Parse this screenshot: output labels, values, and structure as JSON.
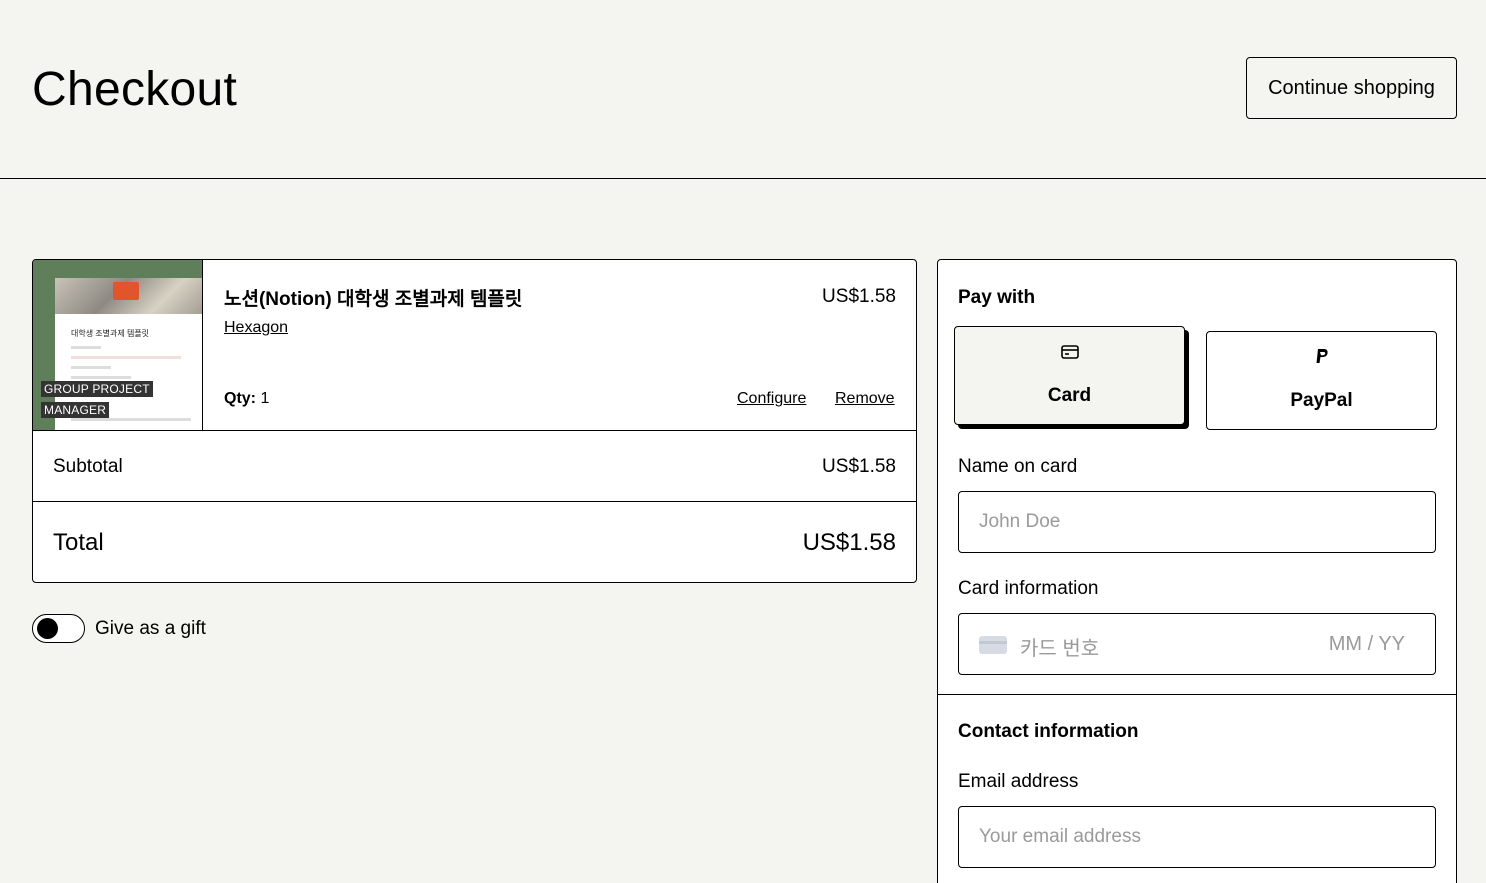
{
  "header": {
    "title": "Checkout",
    "continue_label": "Continue shopping"
  },
  "cart": {
    "item": {
      "name": "노션(Notion) 대학생 조별과제 템플릿",
      "seller": "Hexagon",
      "price": "US$1.58",
      "qty_label": "Qty:",
      "qty_value": "1",
      "configure_label": "Configure",
      "remove_label": "Remove",
      "thumbnail": {
        "doc_title": "대학생 조별과제 템플릿",
        "label_line1": "GROUP PROJECT",
        "label_line2": "MANAGER"
      }
    },
    "subtotal_label": "Subtotal",
    "subtotal_value": "US$1.58",
    "total_label": "Total",
    "total_value": "US$1.58"
  },
  "gift": {
    "label": "Give as a gift",
    "enabled": false
  },
  "payment": {
    "title": "Pay with",
    "methods": [
      {
        "label": "Card",
        "icon": "credit-card-icon",
        "selected": true
      },
      {
        "label": "PayPal",
        "icon": "paypal-icon",
        "selected": false
      }
    ],
    "name_label": "Name on card",
    "name_placeholder": "John Doe",
    "card_label": "Card information",
    "card_number_placeholder": "카드 번호",
    "card_expiry_placeholder": "MM / YY",
    "contact_title": "Contact information",
    "email_label": "Email address",
    "email_placeholder": "Your email address"
  }
}
